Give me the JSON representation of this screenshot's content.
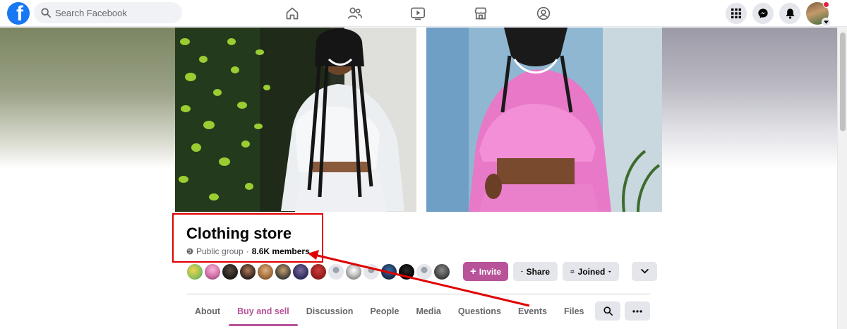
{
  "app": {
    "logo_letter": "f"
  },
  "search": {
    "placeholder": "Search Facebook"
  },
  "nav": {
    "items": [
      {
        "name": "home-icon"
      },
      {
        "name": "friends-icon"
      },
      {
        "name": "watch-icon"
      },
      {
        "name": "marketplace-icon"
      },
      {
        "name": "groups-icon"
      }
    ]
  },
  "header_right": {
    "icons": [
      "menu-grid-icon",
      "messenger-icon",
      "notifications-icon"
    ],
    "has_unread_dot": true
  },
  "group": {
    "name": "Clothing store",
    "privacy": "Public group",
    "separator": "·",
    "members": "8.6K members"
  },
  "actions": {
    "invite": "Invite",
    "share": "Share",
    "joined": "Joined"
  },
  "tabs": [
    {
      "label": "About",
      "active": false
    },
    {
      "label": "Buy and sell",
      "active": true
    },
    {
      "label": "Discussion",
      "active": false
    },
    {
      "label": "People",
      "active": false
    },
    {
      "label": "Media",
      "active": false
    },
    {
      "label": "Questions",
      "active": false
    },
    {
      "label": "Events",
      "active": false
    },
    {
      "label": "Files",
      "active": false
    }
  ],
  "colors": {
    "brand": "#1877f2",
    "accent": "#b8539a",
    "annotation": "#e00000"
  }
}
